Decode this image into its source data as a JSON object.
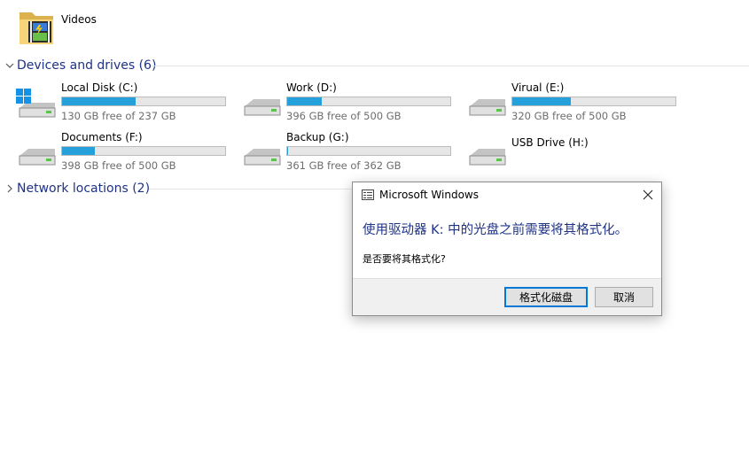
{
  "videos": {
    "label": "Videos",
    "icon": "videos-folder-icon"
  },
  "groups": {
    "devices": {
      "label": "Devices and drives (6)",
      "icon": "chevron-down-icon"
    },
    "network": {
      "label": "Network locations (2)",
      "icon": "chevron-right-icon"
    }
  },
  "drives": [
    {
      "name": "Local Disk (C:)",
      "free": "130 GB free of 237 GB",
      "used_fraction": 0.45,
      "icon": "windows-drive-icon"
    },
    {
      "name": "Work (D:)",
      "free": "396 GB free of 500 GB",
      "used_fraction": 0.21,
      "icon": "hard-drive-icon"
    },
    {
      "name": "Virual (E:)",
      "free": "320 GB free of 500 GB",
      "used_fraction": 0.36,
      "icon": "hard-drive-icon"
    },
    {
      "name": "Documents (F:)",
      "free": "398 GB free of 500 GB",
      "used_fraction": 0.2,
      "icon": "hard-drive-icon"
    },
    {
      "name": "Backup (G:)",
      "free": "361 GB free of 362 GB",
      "used_fraction": 0.003,
      "icon": "hard-drive-icon"
    },
    {
      "name": "USB Drive (H:)",
      "icon": "usb-drive-icon"
    }
  ],
  "dialog": {
    "title": "Microsoft Windows",
    "message": "使用驱动器 K: 中的光盘之前需要将其格式化。",
    "question": "是否要将其格式化?",
    "format_button": "格式化磁盘",
    "cancel_button": "取消"
  },
  "colors": {
    "accent_heading": "#1e3287",
    "progress_fill": "#26a0da",
    "primary_button_border": "#0078d7"
  }
}
